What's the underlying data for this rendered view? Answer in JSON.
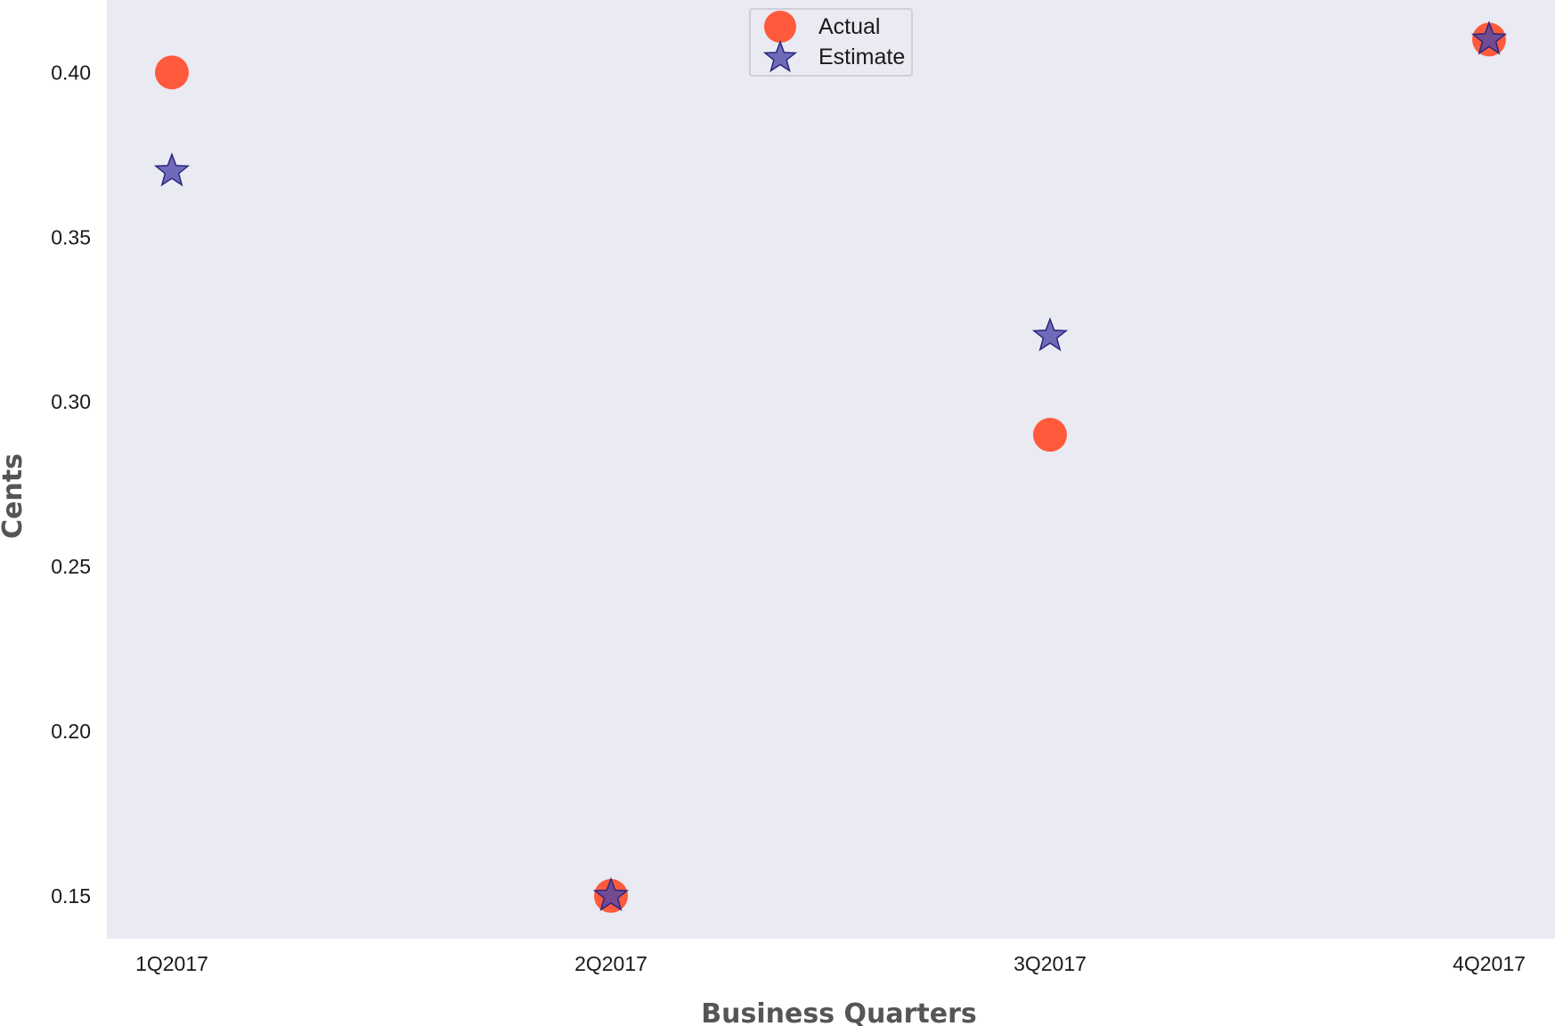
{
  "chart_data": {
    "type": "scatter",
    "categories": [
      "1Q2017",
      "2Q2017",
      "3Q2017",
      "4Q2017"
    ],
    "series": [
      {
        "name": "Actual",
        "marker": "circle",
        "color": "#ff5a3c",
        "values": [
          0.4,
          0.15,
          0.29,
          0.41
        ]
      },
      {
        "name": "Estimate",
        "marker": "star",
        "color": "#4b46a8",
        "values": [
          0.37,
          0.15,
          0.32,
          0.41
        ]
      }
    ],
    "xlabel": "Business Quarters",
    "ylabel": "Cents",
    "ylim": [
      0.137,
      0.422
    ],
    "yticks": [
      "0.15",
      "0.20",
      "0.25",
      "0.30",
      "0.35",
      "0.40"
    ],
    "grid": false,
    "legend_position": "top-center",
    "plot_background": "#eaeaf2"
  }
}
